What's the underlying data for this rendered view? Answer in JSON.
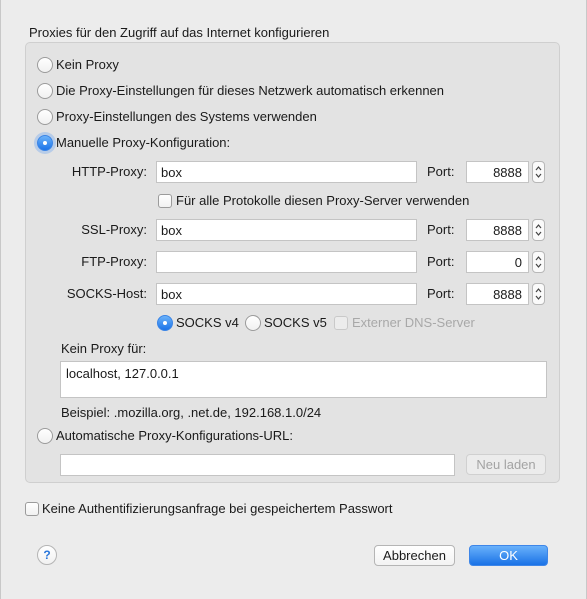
{
  "dialog": {
    "title": "Proxies für den Zugriff auf das Internet konfigurieren"
  },
  "proxy_modes": [
    {
      "label": "Kein Proxy",
      "selected": false
    },
    {
      "label": "Die Proxy-Einstellungen für dieses Netzwerk automatisch erkennen",
      "selected": false
    },
    {
      "label": "Proxy-Einstellungen des Systems verwenden",
      "selected": false
    },
    {
      "label": "Manuelle Proxy-Konfiguration:",
      "selected": true
    }
  ],
  "manual": {
    "port_label": "Port:",
    "http": {
      "label": "HTTP-Proxy:",
      "value": "box",
      "port": "8888"
    },
    "all_protocols_label": "Für alle Protokolle diesen Proxy-Server verwenden",
    "all_protocols_checked": false,
    "ssl": {
      "label": "SSL-Proxy:",
      "value": "box",
      "port": "8888"
    },
    "ftp": {
      "label": "FTP-Proxy:",
      "value": "",
      "port": "0"
    },
    "socks": {
      "label": "SOCKS-Host:",
      "value": "box",
      "port": "8888"
    },
    "socks_v4_label": "SOCKS v4",
    "socks_v4_selected": true,
    "socks_v5_label": "SOCKS v5",
    "socks_v5_selected": false,
    "remote_dns_label": "Externer DNS-Server",
    "remote_dns_checked": false,
    "no_proxy_label": "Kein Proxy für:",
    "no_proxy_value": "localhost, 127.0.0.1",
    "example": "Beispiel: .mozilla.org, .net.de, 192.168.1.0/24"
  },
  "auto_config": {
    "label": "Automatische Proxy-Konfigurations-URL:",
    "selected": false,
    "url_value": "",
    "reload_label": "Neu laden"
  },
  "no_auth_prompt": {
    "label": "Keine Authentifizierungsanfrage bei gespeichertem Passwort",
    "checked": false
  },
  "footer": {
    "help_label": "?",
    "cancel_label": "Abbrechen",
    "ok_label": "OK"
  },
  "colors": {
    "accent": "#1b73e8",
    "background": "#ececec",
    "group_background": "#e3e3e3"
  },
  "icons": {
    "stepper": "up-down-chevron-icon",
    "help": "question-mark-icon"
  }
}
